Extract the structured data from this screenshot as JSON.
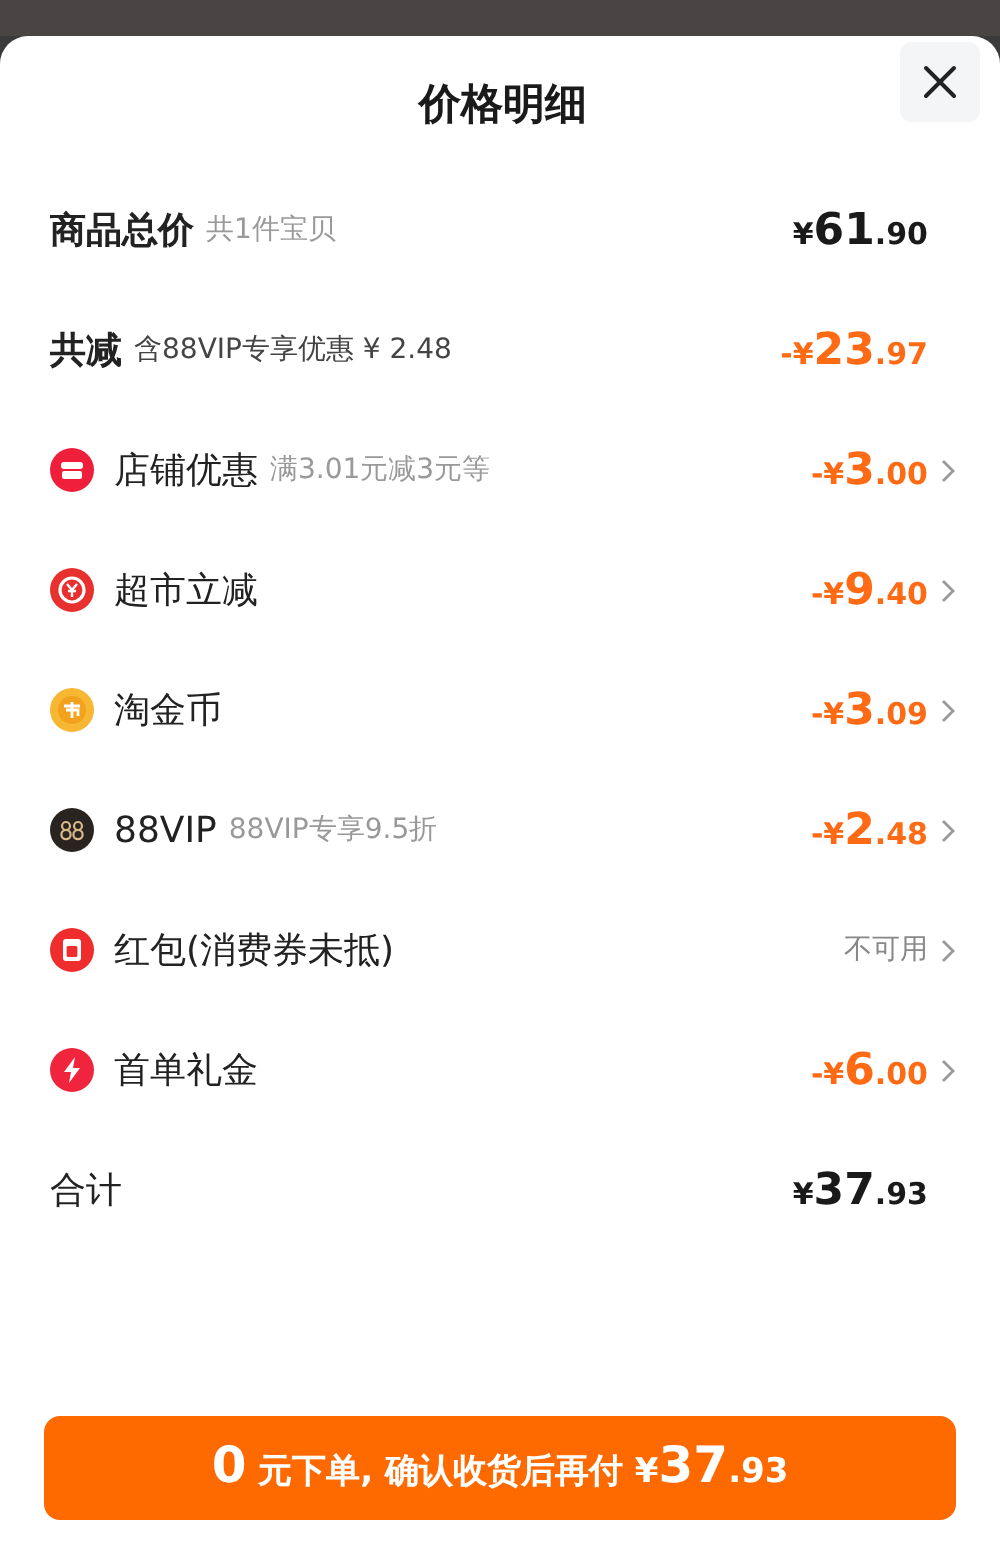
{
  "sheet": {
    "title": "价格明细"
  },
  "summary": [
    {
      "label": "商品总价",
      "note": "共1件宝贝",
      "amount": "¥61.90",
      "kind": "total"
    },
    {
      "label": "共减",
      "note": "含88VIP专享优惠 ¥ 2.48",
      "amount": "-¥23.97",
      "kind": "discount"
    }
  ],
  "items": [
    {
      "label": "店铺优惠",
      "note": "满3.01元减3元等",
      "amount": "-¥3.00",
      "available": true
    },
    {
      "label": "超市立减",
      "amount": "-¥9.40",
      "available": true
    },
    {
      "label": "淘金币",
      "amount": "-¥3.09",
      "available": true
    },
    {
      "label": "88VIP",
      "note": "88VIP专享9.5折",
      "amount": "-¥2.48",
      "available": true
    },
    {
      "label": "红包(消费券未抵)",
      "amount": "不可用",
      "available": false
    },
    {
      "label": "首单礼金",
      "amount": "-¥6.00",
      "available": true
    }
  ],
  "total": {
    "label": "合计",
    "amount": "¥37.93"
  },
  "button": {
    "label": "0 元下单, 确认收货后再付 ¥37.93"
  }
}
